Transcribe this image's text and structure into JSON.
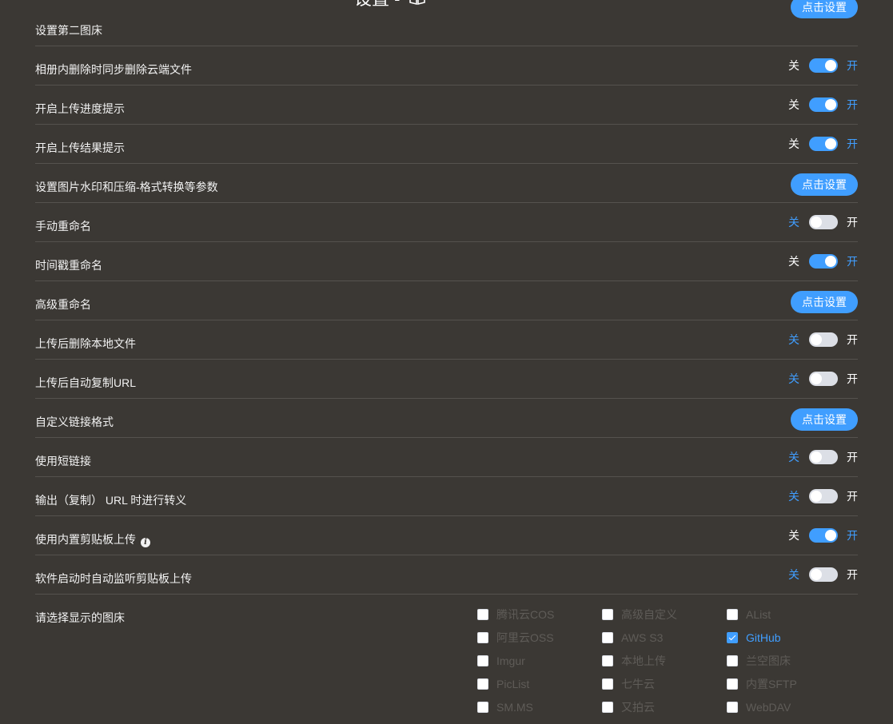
{
  "page_title": "设置 -",
  "switch_off_label": "关",
  "switch_on_label": "开",
  "settings": [
    {
      "label": "设置第二图床",
      "type": "button",
      "button_label": "点击设置"
    },
    {
      "label": "相册内删除时同步删除云端文件",
      "type": "switch",
      "on": true
    },
    {
      "label": "开启上传进度提示",
      "type": "switch",
      "on": true
    },
    {
      "label": "开启上传结果提示",
      "type": "switch",
      "on": true
    },
    {
      "label": "设置图片水印和压缩-格式转换等参数",
      "type": "button",
      "button_label": "点击设置"
    },
    {
      "label": "手动重命名",
      "type": "switch",
      "on": false
    },
    {
      "label": "时间戳重命名",
      "type": "switch",
      "on": true
    },
    {
      "label": "高级重命名",
      "type": "button",
      "button_label": "点击设置"
    },
    {
      "label": "上传后删除本地文件",
      "type": "switch",
      "on": false
    },
    {
      "label": "上传后自动复制URL",
      "type": "switch",
      "on": false
    },
    {
      "label": "自定义链接格式",
      "type": "button",
      "button_label": "点击设置"
    },
    {
      "label": "使用短链接",
      "type": "switch",
      "on": false
    },
    {
      "label": "输出（复制） URL 时进行转义",
      "type": "switch",
      "on": false
    },
    {
      "label": "使用内置剪贴板上传",
      "type": "switch",
      "on": true,
      "info_icon": "info-icon"
    },
    {
      "label": "软件启动时自动监听剪贴板上传",
      "type": "switch",
      "on": false
    }
  ],
  "picbed": {
    "label": "请选择显示的图床",
    "columns": [
      [
        {
          "name": "腾讯云COS",
          "checked": false
        },
        {
          "name": "阿里云OSS",
          "checked": false
        },
        {
          "name": "Imgur",
          "checked": false
        },
        {
          "name": "PicList",
          "checked": false
        },
        {
          "name": "SM.MS",
          "checked": false
        }
      ],
      [
        {
          "name": "高级自定义",
          "checked": false
        },
        {
          "name": "AWS S3",
          "checked": false
        },
        {
          "name": "本地上传",
          "checked": false
        },
        {
          "name": "七牛云",
          "checked": false
        },
        {
          "name": "又拍云",
          "checked": false
        }
      ],
      [
        {
          "name": "AList",
          "checked": false
        },
        {
          "name": "GitHub",
          "checked": true
        },
        {
          "name": "兰空图床",
          "checked": false
        },
        {
          "name": "内置SFTP",
          "checked": false
        },
        {
          "name": "WebDAV",
          "checked": false
        }
      ]
    ]
  },
  "colors": {
    "background": "#3b3834",
    "accent": "#409eff",
    "divider": "#55524e",
    "switch_off": "#dcdfe6",
    "disabled_text": "#5f5c58"
  }
}
